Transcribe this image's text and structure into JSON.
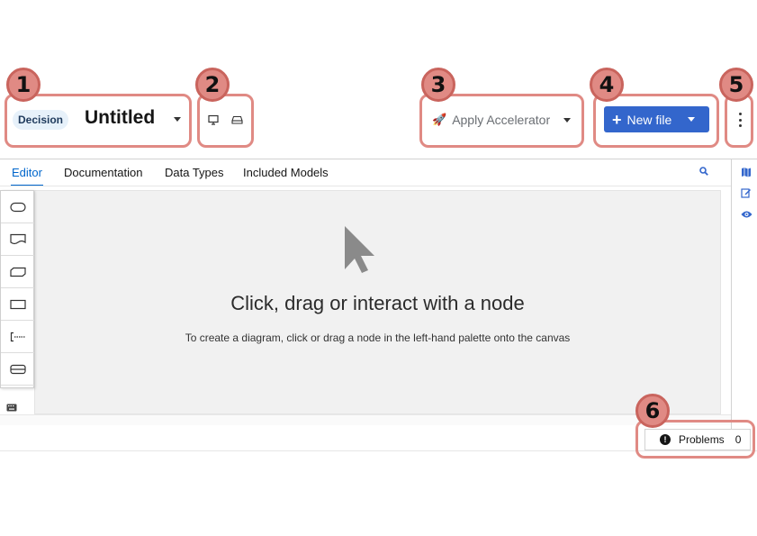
{
  "header": {
    "model_type_badge": "Decision",
    "title": "Untitled",
    "accelerator_label": "Apply Accelerator",
    "new_file_label": "New file"
  },
  "tabs": [
    {
      "label": "Editor",
      "active": true
    },
    {
      "label": "Documentation",
      "active": false
    },
    {
      "label": "Data Types",
      "active": false
    },
    {
      "label": "Included Models",
      "active": false
    }
  ],
  "canvas": {
    "empty_title": "Click, drag or interact with a node",
    "empty_description": "To create a diagram, click or drag a node in the left-hand palette onto the canvas"
  },
  "palette": {
    "items": [
      "input-data-icon",
      "knowledge-source-icon",
      "business-knowledge-model-icon",
      "decision-icon",
      "text-annotation-icon",
      "decision-service-icon"
    ]
  },
  "right_rail": {
    "icons": [
      "map-icon",
      "edit-icon",
      "eye-icon"
    ]
  },
  "problems": {
    "label": "Problems",
    "count": "0"
  },
  "callouts": [
    "1",
    "2",
    "3",
    "4",
    "5",
    "6"
  ],
  "colors": {
    "accent": "#3366cc",
    "active_tab": "#0066cc",
    "callout": "#e08a84"
  }
}
